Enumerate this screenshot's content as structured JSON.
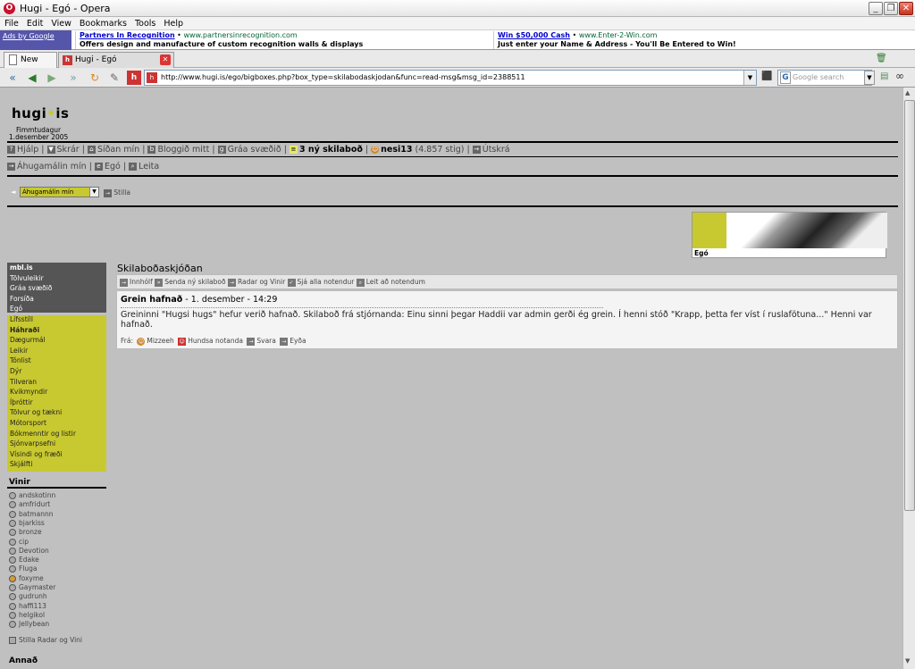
{
  "window": {
    "title": "Hugi - Egó - Opera"
  },
  "menu": [
    "File",
    "Edit",
    "View",
    "Bookmarks",
    "Tools",
    "Help"
  ],
  "ads": {
    "google_label": "Ads by Google",
    "ad1": {
      "title": "Partners In Recognition",
      "url": "www.partnersinrecognition.com",
      "text": "Offers design and manufacture of custom recognition walls & displays"
    },
    "ad2": {
      "title": "Win $50,000 Cash",
      "url": "www.Enter-2-Win.com",
      "text": "Just enter your Name & Address - You'll Be Entered to Win!"
    }
  },
  "tabs": [
    {
      "label": "New page"
    },
    {
      "label": "Hugi - Egó"
    }
  ],
  "address": {
    "url": "http://www.hugi.is/ego/bigboxes.php?box_type=skilabodaskjodan&func=read-msg&msg_id=2388511",
    "search_placeholder": "Google search"
  },
  "site": {
    "logo_a": "hugi",
    "logo_dot": "•",
    "logo_b": "is",
    "day": "Fimmtudagur",
    "date": "1.desember 2005"
  },
  "nav1": {
    "help": "Hjálp",
    "files": "Skrár",
    "mypage": "Síðan mín",
    "blog": "Bloggið mitt",
    "grey": "Gráa svæðið",
    "messages": "3 ný skilaboð",
    "user": "nesi13",
    "points": "(4.857 stig)",
    "logout": "Útskrá"
  },
  "nav2": {
    "interests": "Áhugamálin mín",
    "ego": "Egó",
    "search": "Leita"
  },
  "selector": {
    "value": "Áhugamálin mín",
    "apply": "Stilla"
  },
  "banner": {
    "label": "Egó"
  },
  "sidebar": {
    "dark": [
      "mbl.is",
      "Tölvuleikir",
      "Gráa svæðið",
      "Forsíða",
      "Egó"
    ],
    "yellow": [
      "Lífsstíll",
      "Háhraði",
      "Dægurmál",
      "Leikir",
      "Tónlist",
      "Dýr",
      "Tilveran",
      "Kvikmyndir",
      "Íþróttir",
      "Tölvur og tækni",
      "Mótorsport",
      "Bókmenntir og listir",
      "Sjónvarpsefni",
      "Vísindi og fræði",
      "Skjálfti"
    ],
    "friends_title": "Vinir",
    "friends": [
      "andskotinn",
      "amfridurt",
      "batmannn",
      "bjarkiss",
      "bronze",
      "cip",
      "Devotion",
      "Edake",
      "Fluga",
      "foxyme",
      "Gaymaster",
      "gudrunh",
      "haffi113",
      "helgikol",
      "Jellybean"
    ],
    "friends_settings": "Stilla Radar og Vini",
    "other_title": "Annað"
  },
  "main": {
    "title": "Skilaboðaskjóðan",
    "toolbar": [
      "Innhólf",
      "Senda ný skilaboð",
      "Radar og Vinir",
      "Sjá alla notendur",
      "Leit að notendum"
    ],
    "message": {
      "subject": "Grein hafnað",
      "date": " - 1. desember - 14:29",
      "body": "Greininni \"Hugsi hugs\" hefur verið hafnað. Skilaboð frá stjórnanda: Einu sinni þegar Haddii var admin gerði ég grein. Í henni stóð \"Krapp, þetta fer víst í ruslafötuna...\" Henni var hafnað.",
      "from_label": "Frá:",
      "from": "Mizzeeh",
      "ignore": "Hundsa notanda",
      "reply": "Svara",
      "delete": "Eyða"
    }
  }
}
